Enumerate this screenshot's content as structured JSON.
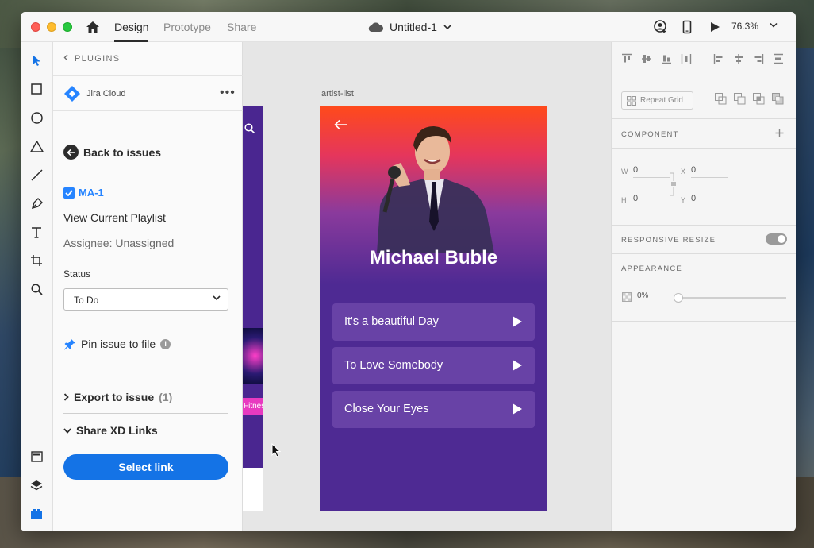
{
  "app": {
    "tabs": [
      {
        "label": "Design",
        "active": true
      },
      {
        "label": "Prototype",
        "active": false
      },
      {
        "label": "Share",
        "active": false
      }
    ],
    "document_title": "Untitled-1",
    "zoom": "76.3%"
  },
  "plugin_panel": {
    "back_label": "PLUGINS",
    "plugin_name": "Jira Cloud",
    "back_to_issues": "Back to issues",
    "issue_key": "MA-1",
    "issue_title": "View Current Playlist",
    "assignee": "Assignee: Unassigned",
    "status_label": "Status",
    "status_value": "To Do",
    "pin_label": "Pin issue to file",
    "export_label": "Export to issue",
    "export_count": "(1)",
    "share_label": "Share XD Links",
    "select_link_label": "Select link",
    "accent_color": "#1473e6"
  },
  "canvas": {
    "artboard_label": "artist-list",
    "artist_name": "Michael Buble",
    "songs": [
      "It's a beautiful Day",
      "To Love Somebody",
      "Close Your Eyes"
    ],
    "other_artboard_tag": "Fitnes"
  },
  "inspector": {
    "repeat_grid_label": "Repeat Grid",
    "component_label": "COMPONENT",
    "fields": {
      "w_label": "W",
      "w_value": "0",
      "h_label": "H",
      "h_value": "0",
      "x_label": "X",
      "x_value": "0",
      "y_label": "Y",
      "y_value": "0"
    },
    "responsive_label": "RESPONSIVE RESIZE",
    "appearance_label": "APPEARANCE",
    "opacity_value": "0%"
  }
}
